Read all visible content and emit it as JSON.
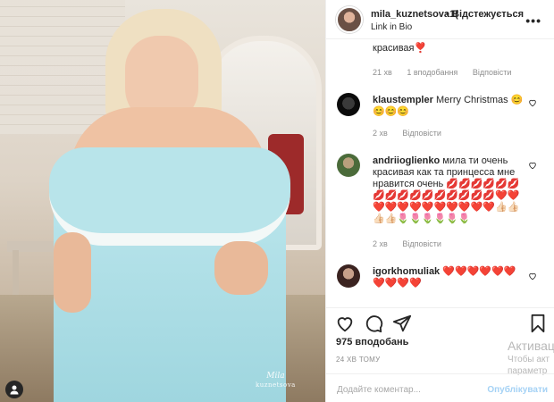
{
  "header": {
    "username": "mila_kuznetsova1(",
    "separator": "•",
    "follow_label": "Відстежується",
    "bio": "Link in Bio",
    "more_icon": "more-dots-icon"
  },
  "photo": {
    "watermark_line1": "Mila",
    "watermark_line2": "kuznetsova"
  },
  "comments": [
    {
      "text": "красивая❣️",
      "age": "21 хв",
      "likes": "1 вподобання",
      "reply": "Відповісти"
    },
    {
      "user": "klaustempler",
      "text": "Merry Christmas 😊😊😊😊",
      "age": "2 хв",
      "reply": "Відповісти"
    },
    {
      "user": "andriioglienko",
      "text": "мила ти очень красивая как та принцесса мне нравится очень 💋💋💋💋💋💋💋💋💋💋💋💋💋💋💋💋❤️❤️❤️❤️❤️❤️❤️❤️❤️❤️❤️❤️👍🏻👍🏻👍🏻👍🏻🌷🌷🌷🌷🌷🌷",
      "age": "2 хв",
      "reply": "Відповісти"
    },
    {
      "user": "igorkhomuliak",
      "text": "❤️❤️❤️❤️❤️❤️❤️❤️❤️❤️"
    }
  ],
  "post": {
    "likes": "975 вподобань",
    "time": "24 ХВ ТОМУ",
    "add_comment_placeholder": "Додайте коментар...",
    "publish_label": "Опублікувати"
  },
  "windows_overlay": {
    "line1": "Активац",
    "line2": "Чтобы акт",
    "line3": "параметр"
  },
  "colors": {
    "accent": "#0095f6",
    "publish_disabled": "#b2dffc",
    "muted": "#8e8e8e"
  }
}
